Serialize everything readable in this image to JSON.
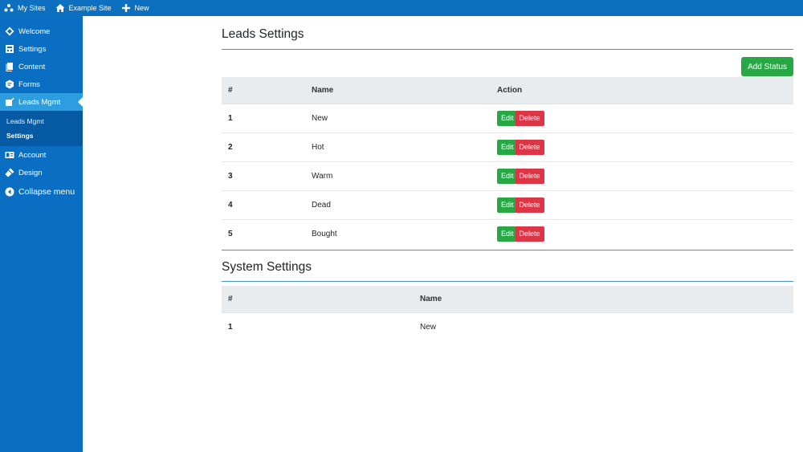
{
  "adminbar": {
    "my_sites": "My Sites",
    "site_name": "Example Site",
    "new_label": "New"
  },
  "sidebar": {
    "items": [
      {
        "label": "Welcome",
        "icon": "welcome-icon"
      },
      {
        "label": "Settings",
        "icon": "settings-icon"
      },
      {
        "label": "Content",
        "icon": "content-icon"
      },
      {
        "label": "Forms",
        "icon": "forms-icon"
      },
      {
        "label": "Leads Mgmt",
        "icon": "leads-icon"
      },
      {
        "label": "Account",
        "icon": "account-icon"
      },
      {
        "label": "Design",
        "icon": "design-icon"
      },
      {
        "label": "Collapse menu",
        "icon": "collapse-icon"
      }
    ],
    "submenu": [
      "Leads Mgmt",
      "Settings"
    ]
  },
  "leads": {
    "title": "Leads Settings",
    "add_button": "Add Status",
    "columns": [
      "#",
      "Name",
      "Action"
    ],
    "rows": [
      {
        "num": "1",
        "name": "New"
      },
      {
        "num": "2",
        "name": "Hot"
      },
      {
        "num": "3",
        "name": "Warm"
      },
      {
        "num": "4",
        "name": "Dead"
      },
      {
        "num": "5",
        "name": "Bought"
      }
    ],
    "edit_label": "Edit",
    "delete_label": "Delete"
  },
  "system": {
    "title": "System Settings",
    "columns": [
      "#",
      "Name"
    ],
    "rows": [
      {
        "num": "1",
        "name": "New"
      }
    ]
  },
  "colors": {
    "sidebar": "#0a6fc2",
    "active": "#2e9de0",
    "success": "#28a745",
    "danger": "#dc3545"
  }
}
